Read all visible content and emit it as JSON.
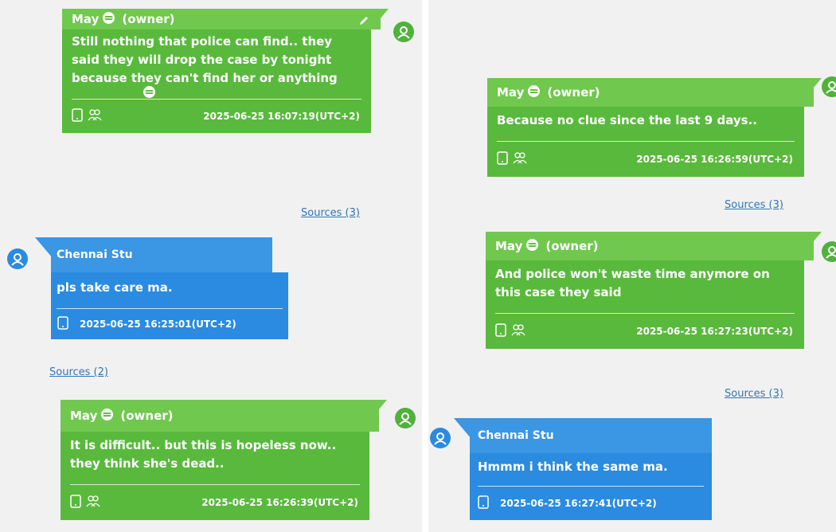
{
  "left_column": {
    "messages": [
      {
        "sender": "May",
        "role": "(owner)",
        "text": "Still nothing that police can find.. they said they will drop the case by tonight because they can't find her or anything",
        "timestamp": "2025-06-25 16:07:19(UTC+2)",
        "sources": "Sources (3)"
      },
      {
        "sender": "Chennai Stu",
        "text": "pls take care ma.",
        "timestamp": "2025-06-25 16:25:01(UTC+2)",
        "sources": "Sources (2)"
      },
      {
        "sender": "May",
        "role": "(owner)",
        "text": "It is difficult.. but this is hopeless now.. they think she's dead..",
        "timestamp": "2025-06-25 16:26:39(UTC+2)"
      }
    ]
  },
  "right_column": {
    "messages": [
      {
        "sender": "May",
        "role": "(owner)",
        "text": "Because no clue since the last 9 days..",
        "timestamp": "2025-06-25 16:26:59(UTC+2)",
        "sources": "Sources (3)"
      },
      {
        "sender": "May",
        "role": "(owner)",
        "text": "And police won't waste time anymore on this case they said",
        "timestamp": "2025-06-25 16:27:23(UTC+2)",
        "sources": "Sources (3)"
      },
      {
        "sender": "Chennai Stu",
        "text": "Hmmm i think the same ma.",
        "timestamp": "2025-06-25 16:27:41(UTC+2)"
      }
    ]
  },
  "colors": {
    "owner_bubble": "#59b93c",
    "owner_header": "#70c84e",
    "contact_bubble": "#2a8be0",
    "contact_header": "#3b96e3",
    "sources_link": "#3175b8",
    "background": "#f1f1f1"
  },
  "icons": [
    "user-avatar-icon",
    "grinning-emoji-icon",
    "edit-pencil-icon",
    "phone-device-icon",
    "group-chat-icon"
  ]
}
